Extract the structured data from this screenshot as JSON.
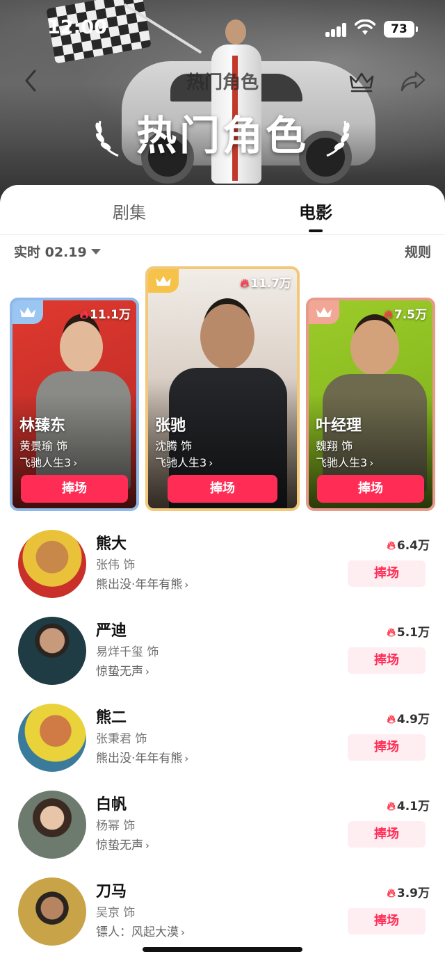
{
  "status": {
    "time": "12:00",
    "battery": "73"
  },
  "nav": {
    "title": "热门角色"
  },
  "hero": {
    "title": "热门角色"
  },
  "tabs": [
    {
      "label": "剧集"
    },
    {
      "label": "电影"
    }
  ],
  "active_tab": "电影",
  "filter": {
    "realtime": "实时 02.19"
  },
  "rules": "规则",
  "top3": [
    {
      "name": "林臻东",
      "actor": "黄景瑜 饰",
      "work": "飞驰人生3",
      "heat": "11.1万",
      "button": "捧场",
      "rank": 2,
      "accent": "#8fb9e8"
    },
    {
      "name": "张驰",
      "actor": "沈腾 饰",
      "work": "飞驰人生3",
      "heat": "11.7万",
      "button": "捧场",
      "rank": 1,
      "accent": "#f2c97a"
    },
    {
      "name": "叶经理",
      "actor": "魏翔 饰",
      "work": "飞驰人生3",
      "heat": "7.5万",
      "button": "捧场",
      "rank": 3,
      "accent": "#e89a8a"
    }
  ],
  "list": [
    {
      "name": "熊大",
      "actor": "张伟 饰",
      "work": "熊出没·年年有熊",
      "heat": "6.4万",
      "button": "捧场"
    },
    {
      "name": "严迪",
      "actor": "易烊千玺 饰",
      "work": "惊蛰无声",
      "heat": "5.1万",
      "button": "捧场"
    },
    {
      "name": "熊二",
      "actor": "张秉君 饰",
      "work": "熊出没·年年有熊",
      "heat": "4.9万",
      "button": "捧场"
    },
    {
      "name": "白帆",
      "actor": "杨幂 饰",
      "work": "惊蛰无声",
      "heat": "4.1万",
      "button": "捧场"
    },
    {
      "name": "刀马",
      "actor": "吴京 饰",
      "work": "镖人：风起大漠",
      "heat": "3.9万",
      "button": "捧场"
    }
  ],
  "colors": {
    "accent": "#ff2d55",
    "button_soft": "#ffeef1",
    "flame": "#ff3b4e"
  }
}
